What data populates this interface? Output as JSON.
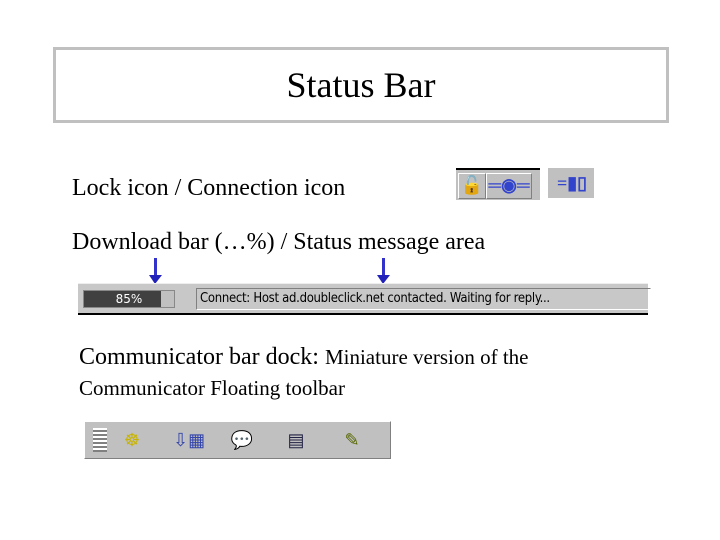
{
  "title": "Status Bar",
  "lines": {
    "lock": "Lock icon / Connection icon",
    "download": "Download bar (…%) / Status message area",
    "dock_a": "Communicator bar dock: ",
    "dock_b": "Miniature version of the",
    "dock_c": "Communicator Floating toolbar"
  },
  "statusbar": {
    "progress_percent": 85,
    "progress_label": "85%",
    "message": "Connect: Host ad.doubleclick.net contacted. Waiting for reply..."
  },
  "icons": [
    "lock-icon",
    "connection-icon",
    "connection-unplugged-icon",
    "dock-grip-icon",
    "navigator-icon",
    "mail-icon",
    "discussion-icon",
    "address-book-icon",
    "composer-icon"
  ],
  "colors": {
    "accent": "#3333cc",
    "chrome": "#c0c0c0"
  }
}
